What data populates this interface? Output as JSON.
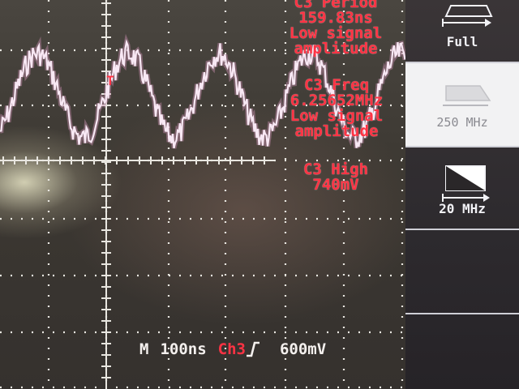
{
  "measurements": {
    "period": {
      "line1": "C3 Period",
      "line2": "159.83ns",
      "line3": "Low signal",
      "line4": "amplitude"
    },
    "freq": {
      "line1": "C3 Freq",
      "line2": "6.25652MHz",
      "line3": "Low signal",
      "line4": "amplitude"
    },
    "high": {
      "line1": "C3 High",
      "line2": "740mV"
    }
  },
  "trigger_marker": "T",
  "status_bar": {
    "timebase_label": "M",
    "timebase": "100ns",
    "trigger_source": "Ch3",
    "trigger_level": "600mV"
  },
  "bandwidth_menu": {
    "full": "Full",
    "mhz250": "250 MHz",
    "mhz20": "20 MHz",
    "selected": "250 MHz"
  },
  "colors": {
    "trace": "#f8e8f4",
    "measurement_text": "#ff3344",
    "grid": "#e8e6e0"
  }
}
